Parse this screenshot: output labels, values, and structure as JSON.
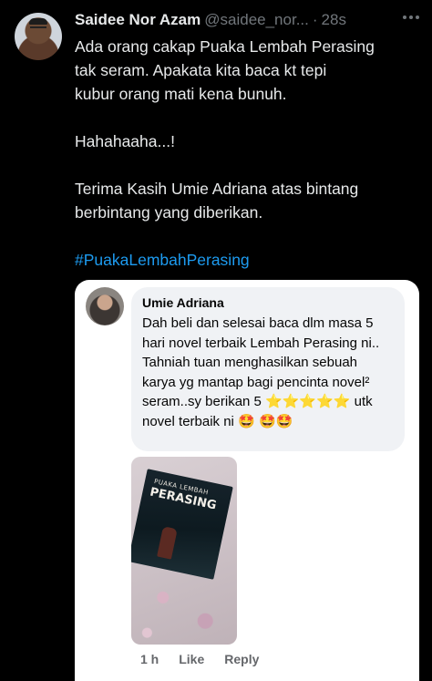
{
  "tweet": {
    "author_name": "Saidee Nor Azam",
    "handle": "@saidee_nor...",
    "separator": "·",
    "time": "28s",
    "text_lines": [
      "Ada orang cakap Puaka Lembah Perasing",
      "tak seram. Apakata kita baca kt tepi",
      "kubur orang mati kena bunuh.",
      "",
      "Hahahaaha...!",
      "",
      "Terima Kasih Umie Adriana atas bintang",
      "berbintang yang diberikan.",
      ""
    ],
    "hashtag": "#PuakaLembahPerasing"
  },
  "embedded_comment": {
    "commenter_name": "Umie Adriana",
    "comment_text": "Dah beli dan selesai baca dlm masa 5 hari novel terbaik Lembah Perasing ni.. Tahniah tuan menghasilkan sebuah karya yg mantap bagi pencinta novel² seram..sy berikan 5",
    "stars": "⭐⭐⭐⭐⭐",
    "comment_tail": "utk novel terbaik ni",
    "emoji_tail": "🤩",
    "emoji_end": "🤩🤩",
    "photo": {
      "book_title_small": "PUAKA LEMBAH",
      "book_title_large": "PERASING"
    },
    "actions": {
      "time": "1 h",
      "like": "Like",
      "reply": "Reply"
    }
  },
  "icons": {
    "more": "more-options-icon"
  }
}
